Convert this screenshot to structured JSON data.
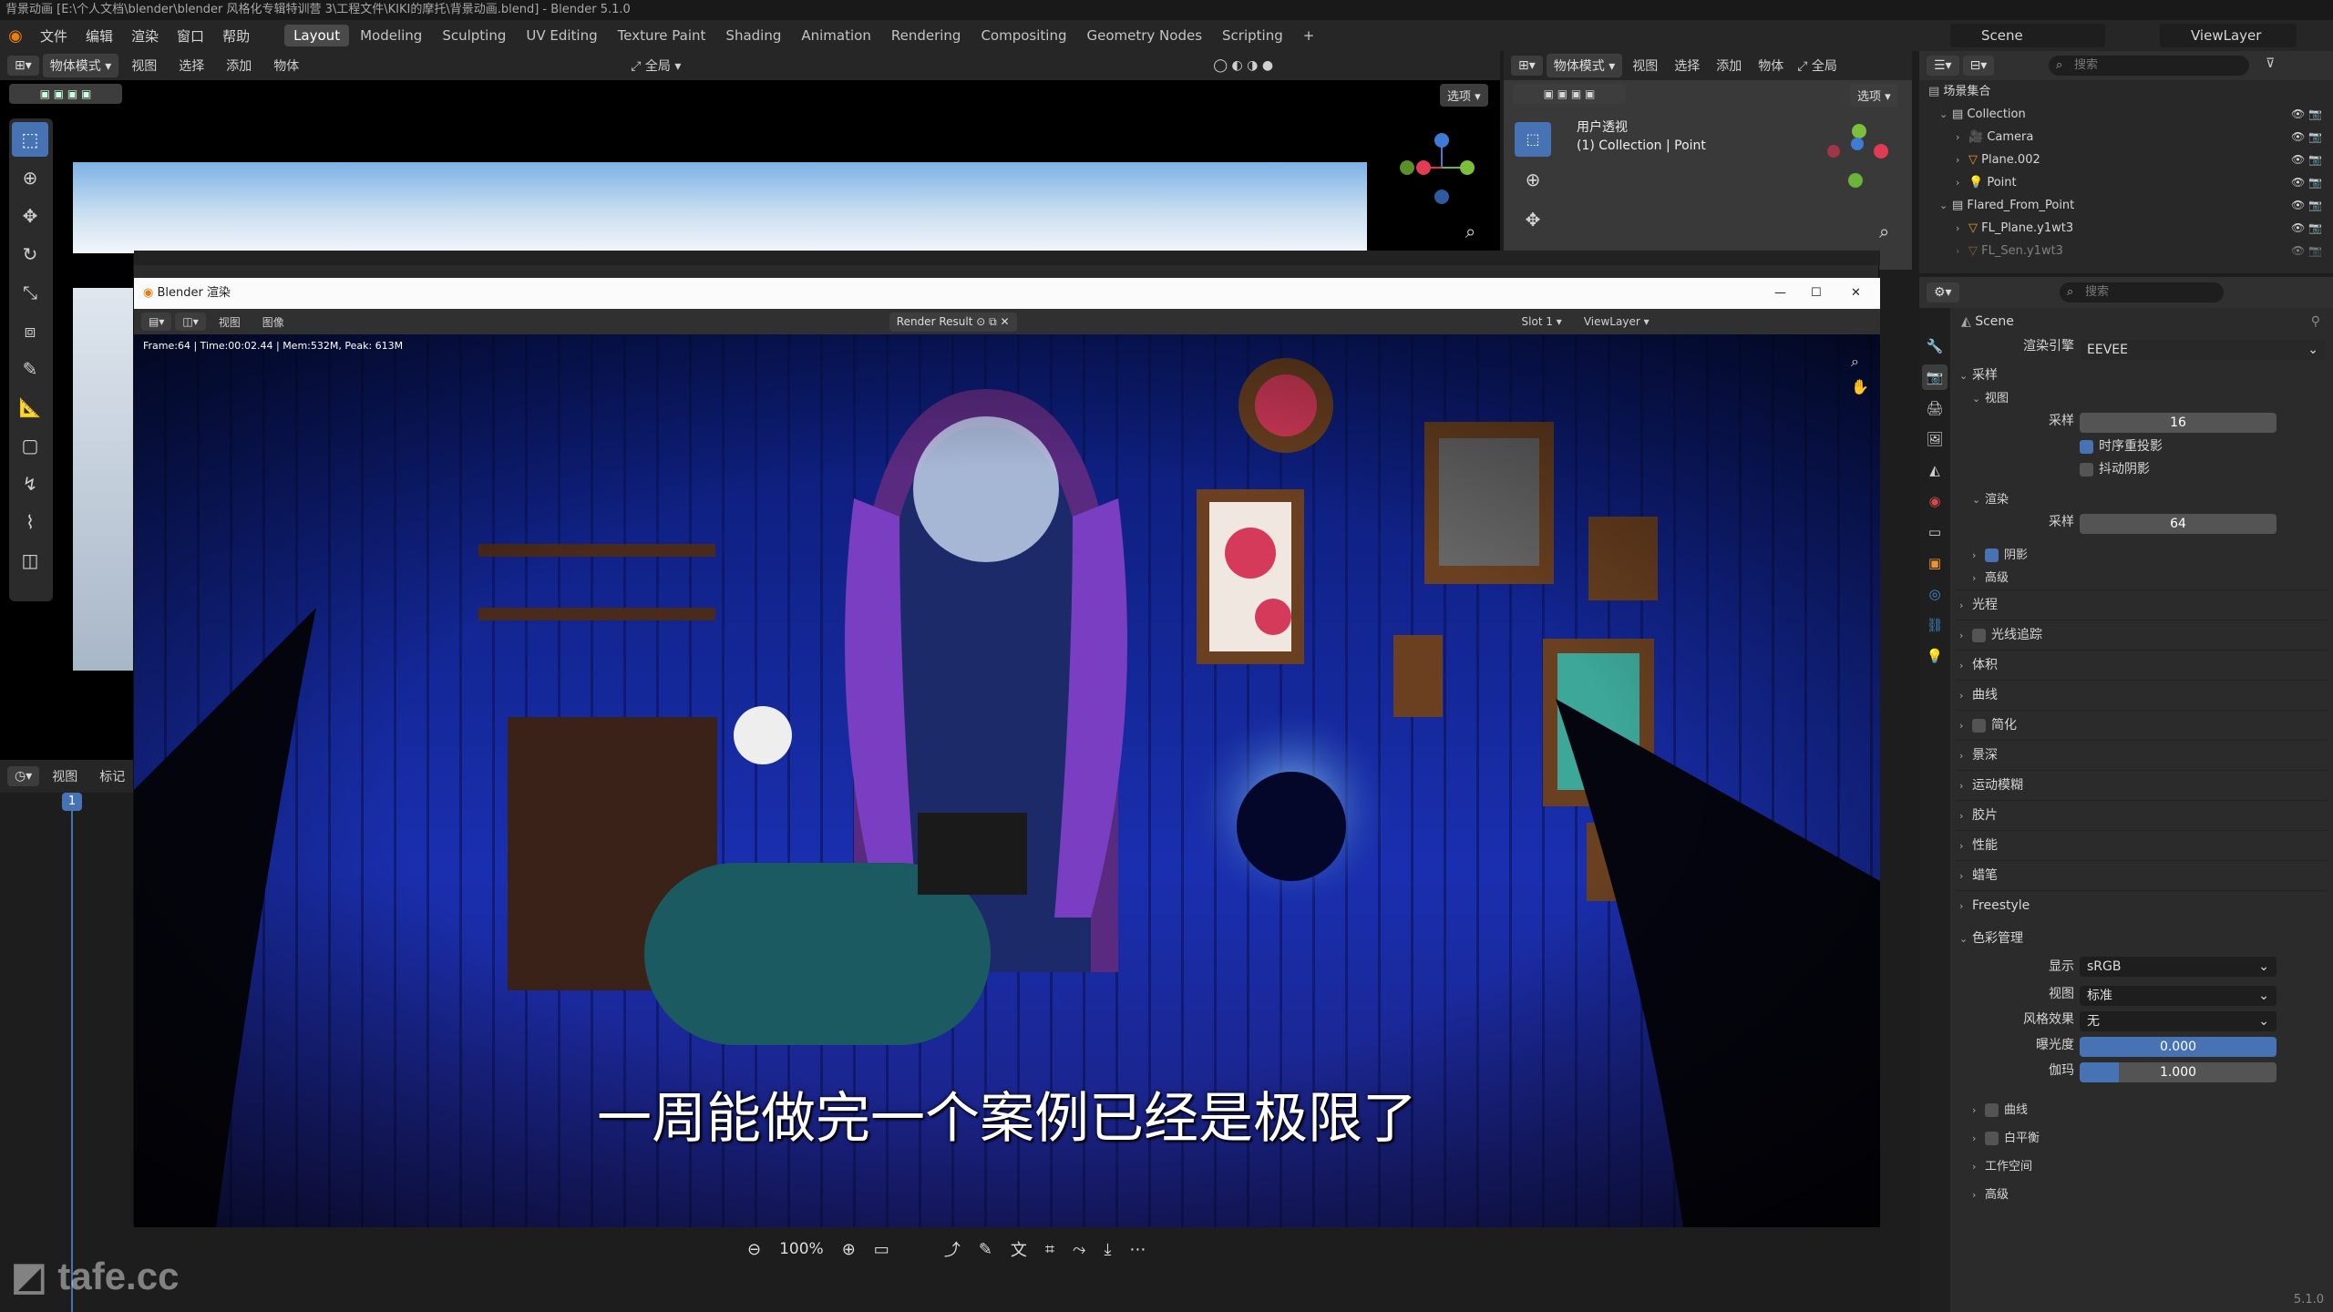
{
  "titlebar": {
    "text": "背景动画 [E:\\个人文档\\blender\\blender 风格化专辑特训营 3\\工程文件\\KIKI的摩托\\背景动画.blend] - Blender 5.1.0"
  },
  "menu": [
    "文件",
    "编辑",
    "渲染",
    "窗口",
    "帮助"
  ],
  "workspaces": [
    "Layout",
    "Modeling",
    "Sculpting",
    "UV Editing",
    "Texture Paint",
    "Shading",
    "Animation",
    "Rendering",
    "Compositing",
    "Geometry Nodes",
    "Scripting",
    "+"
  ],
  "scene": "Scene",
  "viewlayer": "ViewLayer",
  "viewport": {
    "mode": "物体模式",
    "menus": [
      "视图",
      "选择",
      "添加",
      "物体"
    ],
    "global": "全局",
    "options": "选项"
  },
  "viewport2": {
    "mode": "物体模式",
    "menus": [
      "视图",
      "选择",
      "添加",
      "物体"
    ],
    "global": "全局",
    "options": "选项",
    "info1": "用户透视",
    "info2": "(1) Collection | Point"
  },
  "timeline": {
    "menus": [
      "视图",
      "标记"
    ],
    "frame": "1"
  },
  "render_window": {
    "title": "Blender 渲染",
    "menus": [
      "视图",
      "图像"
    ],
    "result": "Render Result",
    "slot": "Slot 1",
    "viewlayer": "ViewLayer",
    "stats": "Frame:64 | Time:00:02.44 | Mem:532M, Peak: 613M",
    "zoom": "100%",
    "subtitle": "一周能做完一个案例已经是极限了"
  },
  "outliner": {
    "search": "搜索",
    "root": "场景集合",
    "items": [
      {
        "label": "Collection",
        "indent": 1,
        "kind": "collection"
      },
      {
        "label": "Camera",
        "indent": 2,
        "kind": "camera"
      },
      {
        "label": "Plane.002",
        "indent": 2,
        "kind": "mesh"
      },
      {
        "label": "Point",
        "indent": 2,
        "kind": "light"
      },
      {
        "label": "Flared_From_Point",
        "indent": 1,
        "kind": "collection"
      },
      {
        "label": "FL_Plane.y1wt3",
        "indent": 2,
        "kind": "mesh"
      },
      {
        "label": "FL_Sen.y1wt3",
        "indent": 2,
        "kind": "mesh"
      }
    ]
  },
  "properties": {
    "search": "搜索",
    "scene": "Scene",
    "engine_label": "渲染引擎",
    "engine": "EEVEE",
    "sampling": "采样",
    "viewport_sec": "视图",
    "vp_samples_label": "采样",
    "vp_samples": "16",
    "temporal": "时序重投影",
    "jitter": "抖动阴影",
    "render_sec": "渲染",
    "r_samples_label": "采样",
    "r_samples": "64",
    "shadows": "阴影",
    "advanced": "高级",
    "panels": [
      "光程",
      "光线追踪",
      "体积",
      "曲线",
      "简化",
      "景深",
      "运动模糊",
      "胶片",
      "性能",
      "蜡笔",
      "Freestyle"
    ],
    "color_mgmt": "色彩管理",
    "display_label": "显示",
    "display": "sRGB",
    "view_label": "视图",
    "view": "标准",
    "look_label": "风格效果",
    "look": "无",
    "exposure_label": "曝光度",
    "exposure": "0.000",
    "gamma_label": "伽玛",
    "gamma": "1.000",
    "cm_sub": [
      "曲线",
      "白平衡",
      "工作空间",
      "高级"
    ]
  },
  "watermark": "tafe.cc",
  "version": "5.1.0"
}
